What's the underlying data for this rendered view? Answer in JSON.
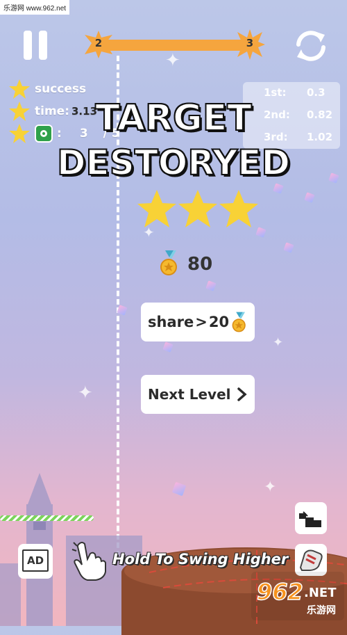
{
  "watermark_top": "乐游网 www.962.net",
  "progress": {
    "current_level": "2",
    "next_level": "3"
  },
  "stats": {
    "result_label": "success",
    "time_label": "time:",
    "time_value": "3.13",
    "time_total": "/ 6",
    "target_sep": ":",
    "target_count": "3",
    "target_total": "/ 5"
  },
  "ranking": [
    {
      "place": "1st:",
      "value": "0.3"
    },
    {
      "place": "2nd:",
      "value": "0.82"
    },
    {
      "place": "3rd:",
      "value": "1.02"
    }
  ],
  "title_line1": "TARGET",
  "title_line2": "DESTORYED",
  "stars_earned": 3,
  "coins": {
    "amount": "80"
  },
  "share_button": {
    "label": "share",
    "reward": "20"
  },
  "next_level_button": {
    "label": "Next Level"
  },
  "ad_button": {
    "label": "AD"
  },
  "hint_text": "Hold To Swing Higher",
  "watermark_bottom": {
    "logo": "962",
    "suffix": ".NET",
    "sub": "乐游网"
  },
  "colors": {
    "accent_orange": "#f5a53e",
    "star_yellow": "#f8d236",
    "text_dark": "#2b2b2b",
    "target_green": "#2fa14a"
  }
}
